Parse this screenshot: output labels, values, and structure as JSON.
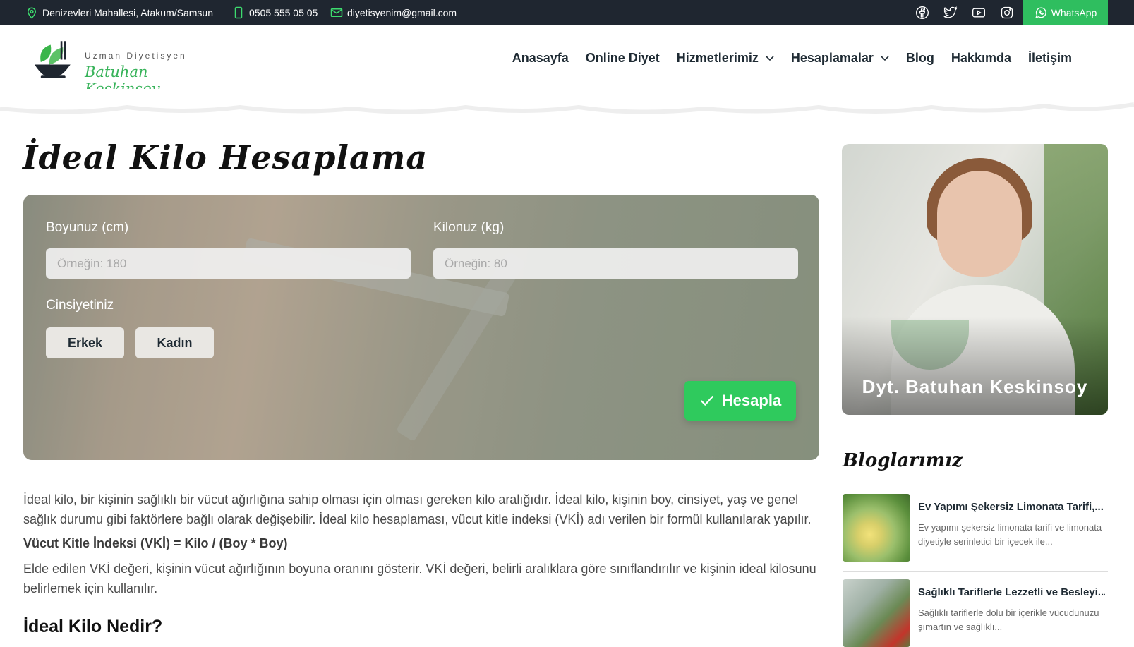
{
  "topbar": {
    "address": "Denizevleri Mahallesi, Atakum/Samsun",
    "phone": "0505 555 05 05",
    "email": "diyetisyenim@gmail.com",
    "whatsapp_label": "WhatsApp",
    "social_icons": [
      "facebook-icon",
      "twitter-icon",
      "youtube-icon",
      "instagram-icon"
    ]
  },
  "logo": {
    "subtitle": "Uzman Diyetisyen",
    "name": "Batuhan Keskinsoy"
  },
  "nav": {
    "items": [
      {
        "label": "Anasayfa"
      },
      {
        "label": "Online Diyet"
      },
      {
        "label": "Hizmetlerimiz"
      },
      {
        "label": "Hesaplamalar"
      },
      {
        "label": "Blog"
      },
      {
        "label": "Hakkımda"
      },
      {
        "label": "İletişim"
      }
    ]
  },
  "page": {
    "title": "İdeal Kilo Hesaplama"
  },
  "calculator": {
    "height_label": "Boyunuz (cm)",
    "height_placeholder": "Örneğin: 180",
    "weight_label": "Kilonuz (kg)",
    "weight_placeholder": "Örneğin: 80",
    "gender_label": "Cinsiyetiniz",
    "male_label": "Erkek",
    "female_label": "Kadın",
    "submit_label": "Hesapla"
  },
  "content": {
    "para1": "İdeal kilo, bir kişinin sağlıklı bir vücut ağırlığına sahip olması için olması gereken kilo aralığıdır. İdeal kilo, kişinin boy, cinsiyet, yaş ve genel sağlık durumu gibi faktörlere bağlı olarak değişebilir. İdeal kilo hesaplaması, vücut kitle indeksi (VKİ) adı verilen bir formül kullanılarak yapılır.",
    "formula": "Vücut Kitle İndeksi (VKİ) = Kilo / (Boy * Boy)",
    "para2": "Elde edilen VKİ değeri, kişinin vücut ağırlığının boyuna oranını gösterir. VKİ değeri, belirli aralıklara göre sınıflandırılır ve kişinin ideal kilosunu belirlemek için kullanılır.",
    "heading": "İdeal Kilo Nedir?"
  },
  "sidebar": {
    "profile_name": "Dyt. Batuhan Keskinsoy",
    "blog_title": "Bloglarımız",
    "posts": [
      {
        "title": "Ev Yapımı Şekersiz Limonata Tarifi,...",
        "excerpt": "Ev yapımı şekersiz limonata tarifi ve limonata diyetiyle serinletici bir içecek ile..."
      },
      {
        "title": "Sağlıklı Tariflerle Lezzetli ve Besleyi...",
        "excerpt": "Sağlıklı tariflerle dolu bir içerikle vücudunuzu şımartın ve sağlıklı..."
      }
    ]
  },
  "colors": {
    "topbar_bg": "#1f2630",
    "accent_green": "#2fca5d",
    "whatsapp_green": "#2fbe5f"
  }
}
